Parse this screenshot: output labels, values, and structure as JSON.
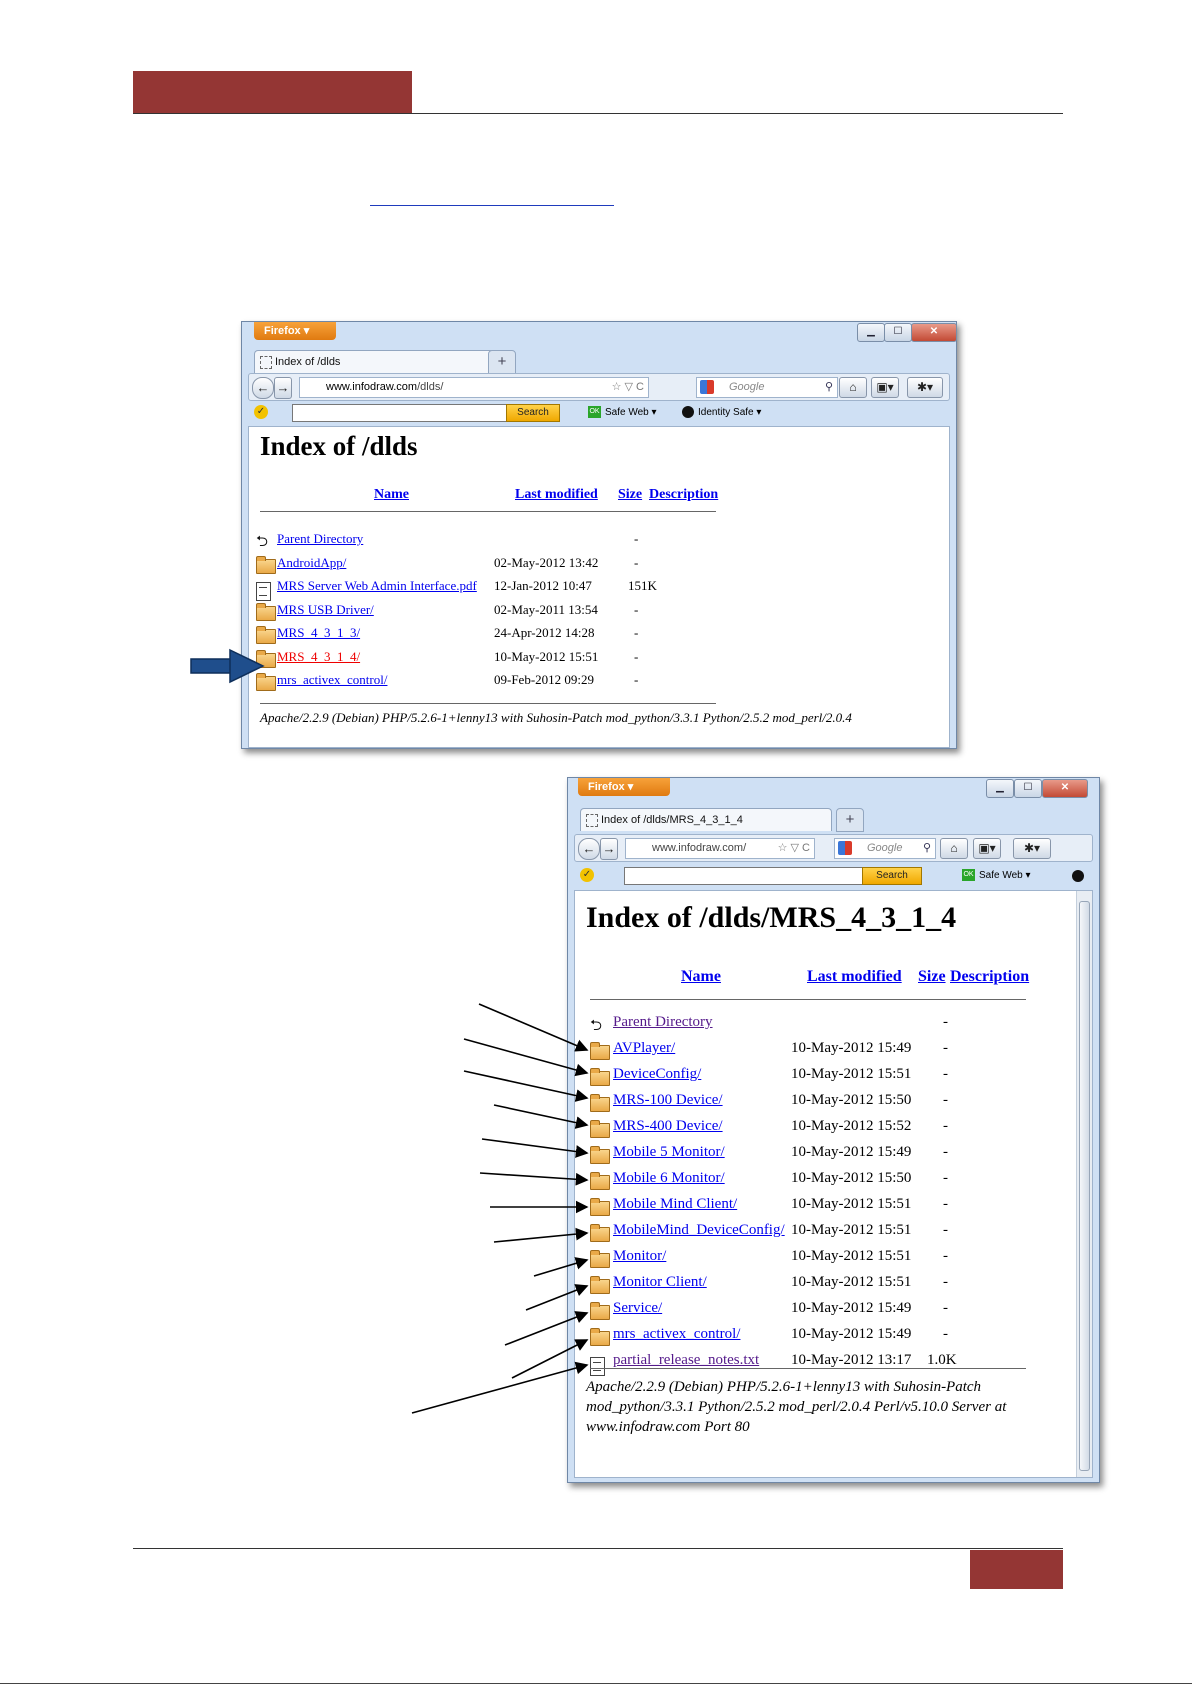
{
  "document": {
    "link_text": ""
  },
  "win1": {
    "menu_button": "Firefox ▾",
    "controls": {
      "min": "▁",
      "max": "☐",
      "close": "✕"
    },
    "tab_title": "Index of /dlds",
    "new_tab": "+",
    "back": "←",
    "forward": "→",
    "url_site": "www.infodraw.com",
    "url_path": "/dlds/",
    "url_icons": "☆ ▽ C",
    "search_engine": "Google",
    "search_icon": "⚲",
    "home": "⌂",
    "bookmarks": "▣▾",
    "addon": "✱▾",
    "norton": "✓",
    "search_button": "Search",
    "safe_web": "Safe Web ▾",
    "identity_safe": "Identity Safe ▾",
    "ok": "OK",
    "page_title": "Index of /dlds",
    "columns": {
      "name": "Name",
      "last_modified": "Last modified",
      "size": "Size",
      "description": "Description"
    },
    "rows": [
      {
        "name": "Parent Directory",
        "date": "",
        "size": "-",
        "icon": "back-icon"
      },
      {
        "name": "AndroidApp/",
        "date": "02-May-2012 13:42",
        "size": "-",
        "icon": "folder-icon"
      },
      {
        "name": "MRS Server Web Admin Interface.pdf",
        "date": "12-Jan-2012 10:47",
        "size": "151K",
        "icon": "file-icon"
      },
      {
        "name": "MRS USB Driver/",
        "date": "02-May-2011 13:54",
        "size": "-",
        "icon": "folder-icon"
      },
      {
        "name": "MRS_4_3_1_3/",
        "date": "24-Apr-2012 14:28",
        "size": "-",
        "icon": "folder-icon"
      },
      {
        "name": "MRS_4_3_1_4/",
        "date": "10-May-2012 15:51",
        "size": "-",
        "icon": "folder-icon",
        "highlight_color": "#ee0000"
      },
      {
        "name": "mrs_activex_control/",
        "date": "09-Feb-2012 09:29",
        "size": "-",
        "icon": "folder-icon"
      }
    ],
    "footer": "Apache/2.2.9 (Debian) PHP/5.2.6-1+lenny13 with Suhosin-Patch mod_python/3.3.1 Python/2.5.2 mod_perl/2.0.4"
  },
  "win2": {
    "menu_button": "Firefox ▾",
    "controls": {
      "min": "▁",
      "max": "☐",
      "close": "✕"
    },
    "tab_title": "Index of /dlds/MRS_4_3_1_4",
    "new_tab": "+",
    "back": "←",
    "forward": "→",
    "url_text": "www.infodraw.com/",
    "url_icons": "☆ ▽ C",
    "search_engine": "Google",
    "search_icon": "⚲",
    "home": "⌂",
    "bookmarks": "▣▾",
    "addon": "✱▾",
    "norton": "✓",
    "search_button": "Search",
    "safe_web": "Safe Web ▾",
    "ok": "OK",
    "page_title": "Index of /dlds/MRS_4_3_1_4",
    "columns": {
      "name": "Name",
      "last_modified": "Last modified",
      "size": "Size",
      "description": "Description"
    },
    "rows": [
      {
        "name": "Parent Directory",
        "date": "",
        "size": "-",
        "icon": "back-icon"
      },
      {
        "name": "AVPlayer/",
        "date": "10-May-2012 15:49",
        "size": "-",
        "icon": "folder-icon"
      },
      {
        "name": "DeviceConfig/",
        "date": "10-May-2012 15:51",
        "size": "-",
        "icon": "folder-icon"
      },
      {
        "name": "MRS-100 Device/",
        "date": "10-May-2012 15:50",
        "size": "-",
        "icon": "folder-icon"
      },
      {
        "name": "MRS-400 Device/",
        "date": "10-May-2012 15:52",
        "size": "-",
        "icon": "folder-icon"
      },
      {
        "name": "Mobile 5 Monitor/",
        "date": "10-May-2012 15:49",
        "size": "-",
        "icon": "folder-icon"
      },
      {
        "name": "Mobile 6 Monitor/",
        "date": "10-May-2012 15:50",
        "size": "-",
        "icon": "folder-icon"
      },
      {
        "name": "Mobile Mind Client/",
        "date": "10-May-2012 15:51",
        "size": "-",
        "icon": "folder-icon"
      },
      {
        "name": "MobileMind_DeviceConfig/",
        "date": "10-May-2012 15:51",
        "size": "-",
        "icon": "folder-icon"
      },
      {
        "name": "Monitor/",
        "date": "10-May-2012 15:51",
        "size": "-",
        "icon": "folder-icon"
      },
      {
        "name": "Monitor Client/",
        "date": "10-May-2012 15:51",
        "size": "-",
        "icon": "folder-icon"
      },
      {
        "name": "Service/",
        "date": "10-May-2012 15:49",
        "size": "-",
        "icon": "folder-icon"
      },
      {
        "name": "mrs_activex_control/",
        "date": "10-May-2012 15:49",
        "size": "-",
        "icon": "folder-icon"
      },
      {
        "name": "partial_release_notes.txt",
        "date": "10-May-2012 13:17",
        "size": "1.0K",
        "icon": "file-icon"
      }
    ],
    "footer_lines": [
      "Apache/2.2.9 (Debian) PHP/5.2.6-1+lenny13 with Suhosin-Patch",
      "mod_python/3.3.1 Python/2.5.2 mod_perl/2.0.4 Perl/v5.10.0 Server at",
      "www.infodraw.com Port 80"
    ]
  },
  "colors": {
    "accent": "#943634",
    "link": "#0000ee",
    "visited": "#551a8b",
    "arrow_blue": "#1f4e8c"
  }
}
